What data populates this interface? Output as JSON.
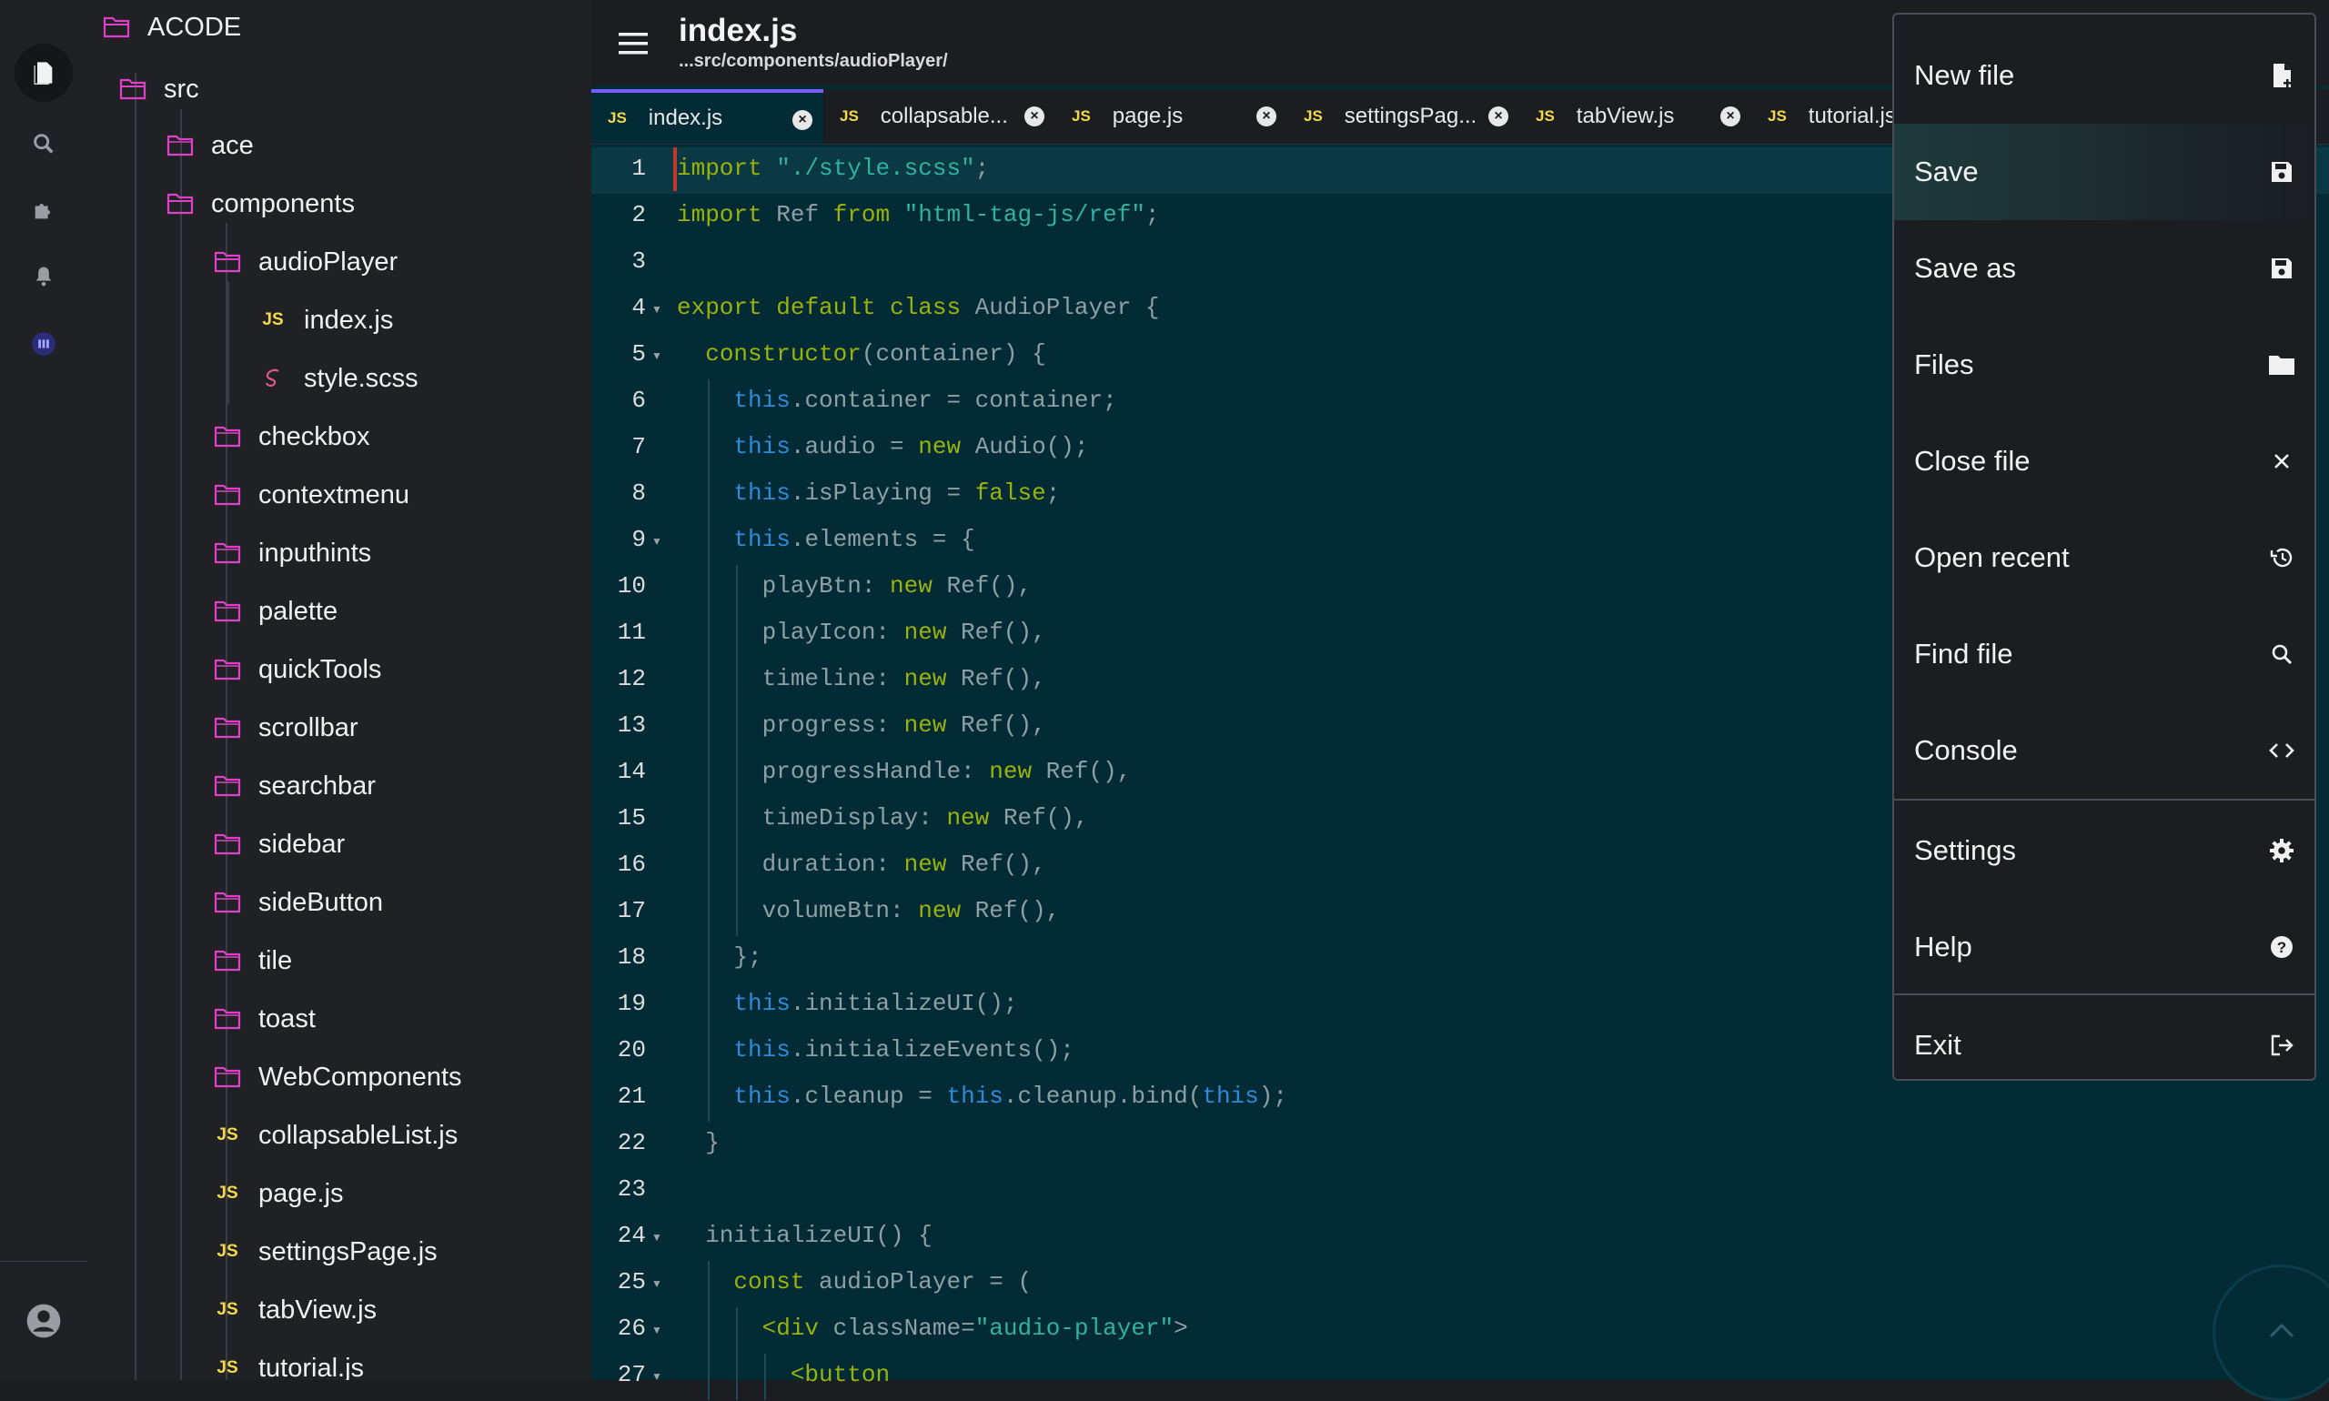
{
  "explorer": {
    "root": "ACODE",
    "items": [
      {
        "label": "src",
        "type": "folder"
      },
      {
        "label": "ace",
        "type": "folder"
      },
      {
        "label": "components",
        "type": "folder"
      },
      {
        "label": "audioPlayer",
        "type": "folder"
      },
      {
        "label": "index.js",
        "type": "js"
      },
      {
        "label": "style.scss",
        "type": "scss"
      },
      {
        "label": "checkbox",
        "type": "folder"
      },
      {
        "label": "contextmenu",
        "type": "folder"
      },
      {
        "label": "inputhints",
        "type": "folder"
      },
      {
        "label": "palette",
        "type": "folder"
      },
      {
        "label": "quickTools",
        "type": "folder"
      },
      {
        "label": "scrollbar",
        "type": "folder"
      },
      {
        "label": "searchbar",
        "type": "folder"
      },
      {
        "label": "sidebar",
        "type": "folder"
      },
      {
        "label": "sideButton",
        "type": "folder"
      },
      {
        "label": "tile",
        "type": "folder"
      },
      {
        "label": "toast",
        "type": "folder"
      },
      {
        "label": "WebComponents",
        "type": "folder"
      },
      {
        "label": "collapsableList.js",
        "type": "js"
      },
      {
        "label": "page.js",
        "type": "js"
      },
      {
        "label": "settingsPage.js",
        "type": "js"
      },
      {
        "label": "tabView.js",
        "type": "js"
      },
      {
        "label": "tutorial.js",
        "type": "js"
      }
    ],
    "js_badge": "JS"
  },
  "header": {
    "title": "index.js",
    "subtitle": "...src/components/audioPlayer/"
  },
  "tabs": [
    {
      "label": "index.js",
      "icon": "JS"
    },
    {
      "label": "collapsable...",
      "icon": "JS"
    },
    {
      "label": "page.js",
      "icon": "JS"
    },
    {
      "label": "settingsPag...",
      "icon": "JS"
    },
    {
      "label": "tabView.js",
      "icon": "JS"
    },
    {
      "label": "tutorial.js",
      "icon": "JS"
    }
  ],
  "code": {
    "line_numbers": [
      "1",
      "2",
      "3",
      "4",
      "5",
      "6",
      "7",
      "8",
      "9",
      "10",
      "11",
      "12",
      "13",
      "14",
      "15",
      "16",
      "17",
      "18",
      "19",
      "20",
      "21",
      "22",
      "23",
      "24",
      "25",
      "26",
      "27"
    ],
    "lines": [
      "import \"./style.scss\";",
      "import Ref from \"html-tag-js/ref\";",
      "",
      "export default class AudioPlayer {",
      "  constructor(container) {",
      "    this.container = container;",
      "    this.audio = new Audio();",
      "    this.isPlaying = false;",
      "    this.elements = {",
      "      playBtn: new Ref(),",
      "      playIcon: new Ref(),",
      "      timeline: new Ref(),",
      "      progress: new Ref(),",
      "      progressHandle: new Ref(),",
      "      timeDisplay: new Ref(),",
      "      duration: new Ref(),",
      "      volumeBtn: new Ref(),",
      "    };",
      "    this.initializeUI();",
      "    this.initializeEvents();",
      "    this.cleanup = this.cleanup.bind(this);",
      "  }",
      "",
      "  initializeUI() {",
      "    const audioPlayer = (",
      "      <div className=\"audio-player\">",
      "        <button"
    ]
  },
  "menu": {
    "items": [
      {
        "label": "New file",
        "icon": "new-file-icon"
      },
      {
        "label": "Save",
        "icon": "save-icon"
      },
      {
        "label": "Save as",
        "icon": "save-as-icon"
      },
      {
        "label": "Files",
        "icon": "folder-icon"
      },
      {
        "label": "Close file",
        "icon": "close-icon"
      },
      {
        "label": "Open recent",
        "icon": "history-icon"
      },
      {
        "label": "Find file",
        "icon": "search-icon"
      },
      {
        "label": "Console",
        "icon": "code-icon"
      },
      {
        "label": "Settings",
        "icon": "gear-icon"
      },
      {
        "label": "Help",
        "icon": "help-icon"
      },
      {
        "label": "Exit",
        "icon": "exit-icon"
      }
    ]
  },
  "colors": {
    "editor_bg": "#022b36",
    "panel_bg": "#1f2125",
    "folder": "#e040c8",
    "js": "#f5d94b",
    "accent": "#7b5cff"
  }
}
